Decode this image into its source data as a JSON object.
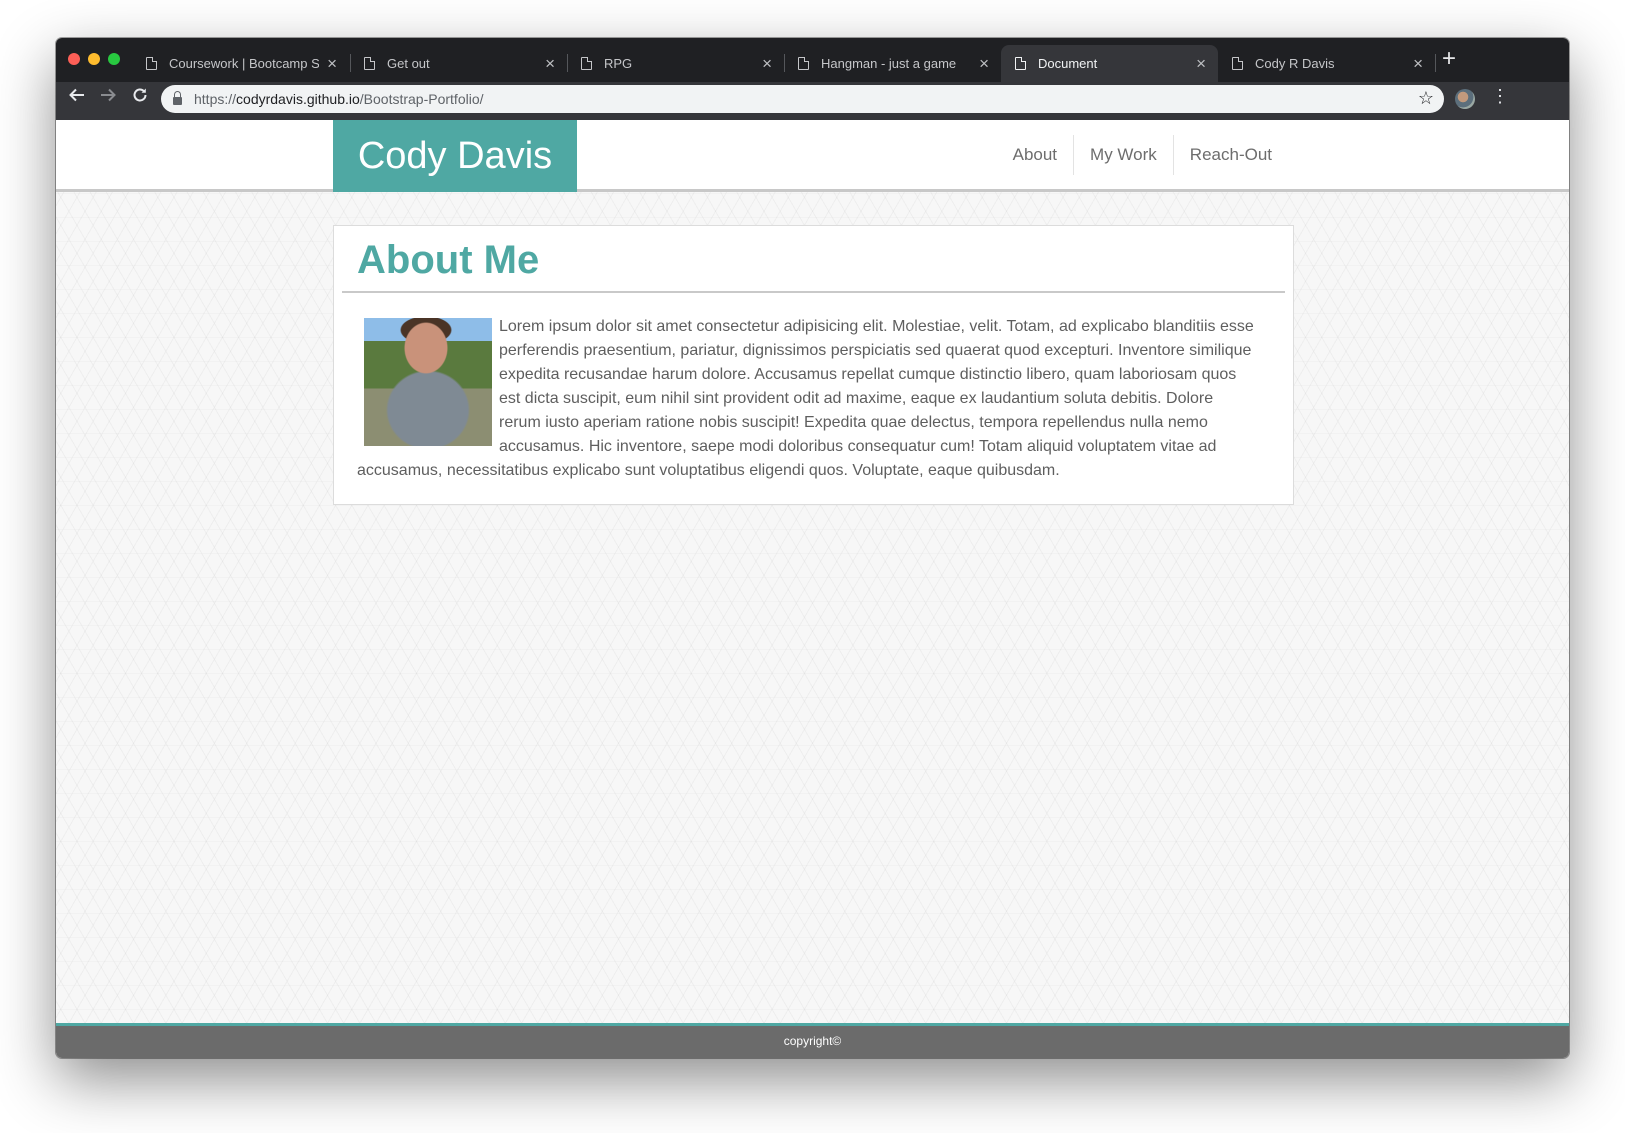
{
  "browser": {
    "tabs": [
      {
        "title": "Coursework | Bootcamp Spot",
        "active": false
      },
      {
        "title": "Get out",
        "active": false
      },
      {
        "title": "RPG",
        "active": false
      },
      {
        "title": "Hangman - just a game",
        "active": false
      },
      {
        "title": "Document",
        "active": true
      },
      {
        "title": "Cody R Davis",
        "active": false
      }
    ],
    "close_glyph": "×",
    "new_tab_glyph": "+",
    "url": {
      "scheme": "https://",
      "host": "codyrdavis.github.io",
      "path": "/Bootstrap-Portfolio/"
    },
    "icons": {
      "back": "arrow-left-icon",
      "forward": "arrow-right-icon",
      "reload": "reload-icon",
      "lock": "lock-icon",
      "bookmark": "star-icon",
      "profile": "avatar-icon",
      "menu": "kebab-menu-icon"
    }
  },
  "site": {
    "brand": "Cody Davis",
    "nav": [
      "About",
      "My Work",
      "Reach-Out"
    ],
    "about": {
      "heading": "About Me",
      "text": "Lorem ipsum dolor sit amet consectetur adipisicing elit. Molestiae, velit. Totam, ad explicabo blanditiis esse perferendis praesentium, pariatur, dignissimos perspiciatis sed quaerat quod excepturi. Inventore similique expedita recusandae harum dolore. Accusamus repellat cumque distinctio libero, quam laboriosam quos est dicta suscipit, eum nihil sint provident odit ad maxime, eaque ex laudantium soluta debitis. Dolore rerum iusto aperiam ratione nobis suscipit! Expedita quae delectus, tempora repellendus nulla nemo accusamus. Hic inventore, saepe modi doloribus consequatur cum! Totam aliquid voluptatem vitae ad accusamus, necessitatibus explicabo sunt voluptatibus eligendi quos. Voluptate, eaque quibusdam."
    },
    "footer": "copyright©"
  },
  "colors": {
    "accent": "#4fa8a3",
    "footer_bg": "#6b6b6b",
    "browser_chrome": "#35363a"
  }
}
